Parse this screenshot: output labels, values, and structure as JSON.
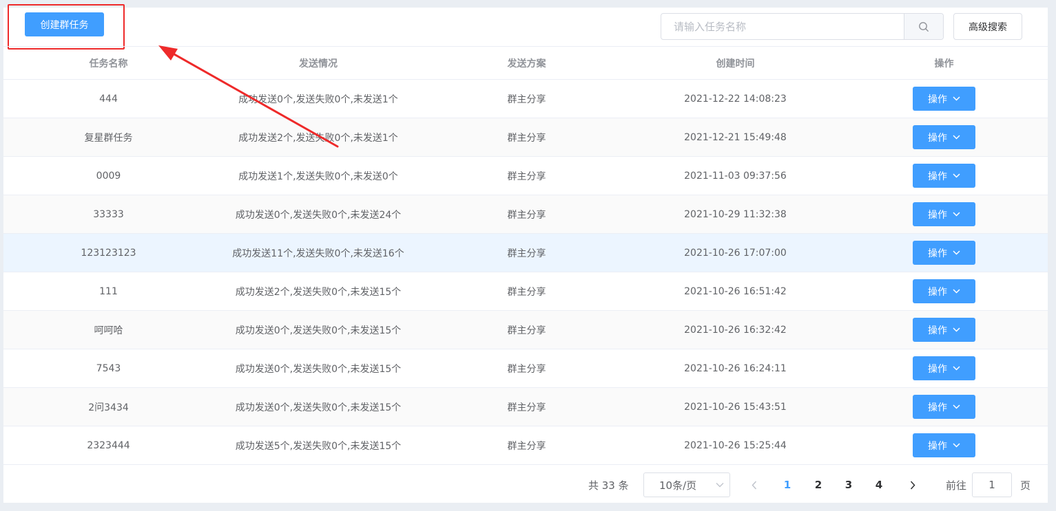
{
  "toolbar": {
    "create_label": "创建群任务",
    "search_placeholder": "请输入任务名称",
    "advanced_label": "高级搜索"
  },
  "table": {
    "columns": [
      "任务名称",
      "发送情况",
      "发送方案",
      "创建时间",
      "操作"
    ],
    "rows": [
      {
        "name": "444",
        "status": "成功发送0个,发送失败0个,未发送1个",
        "plan": "群主分享",
        "time": "2021-12-22 14:08:23",
        "action": "操作"
      },
      {
        "name": "复星群任务",
        "status": "成功发送2个,发送失败0个,未发送1个",
        "plan": "群主分享",
        "time": "2021-12-21 15:49:48",
        "action": "操作"
      },
      {
        "name": "0009",
        "status": "成功发送1个,发送失败0个,未发送0个",
        "plan": "群主分享",
        "time": "2021-11-03 09:37:56",
        "action": "操作"
      },
      {
        "name": "33333",
        "status": "成功发送0个,发送失败0个,未发送24个",
        "plan": "群主分享",
        "time": "2021-10-29 11:32:38",
        "action": "操作"
      },
      {
        "name": "123123123",
        "status": "成功发送11个,发送失败0个,未发送16个",
        "plan": "群主分享",
        "time": "2021-10-26 17:07:00",
        "action": "操作"
      },
      {
        "name": "111",
        "status": "成功发送2个,发送失败0个,未发送15个",
        "plan": "群主分享",
        "time": "2021-10-26 16:51:42",
        "action": "操作"
      },
      {
        "name": "呵呵哈",
        "status": "成功发送0个,发送失败0个,未发送15个",
        "plan": "群主分享",
        "time": "2021-10-26 16:32:42",
        "action": "操作"
      },
      {
        "name": "7543",
        "status": "成功发送0个,发送失败0个,未发送15个",
        "plan": "群主分享",
        "time": "2021-10-26 16:24:11",
        "action": "操作"
      },
      {
        "name": "2问3434",
        "status": "成功发送0个,发送失败0个,未发送15个",
        "plan": "群主分享",
        "time": "2021-10-26 15:43:51",
        "action": "操作"
      },
      {
        "name": "2323444",
        "status": "成功发送5个,发送失败0个,未发送15个",
        "plan": "群主分享",
        "time": "2021-10-26 15:25:44",
        "action": "操作"
      }
    ]
  },
  "pagination": {
    "total_text": "共 33 条",
    "page_size": "10条/页",
    "pages": [
      "1",
      "2",
      "3",
      "4"
    ],
    "current_page": "1",
    "goto_label": "前往",
    "goto_value": "1",
    "goto_suffix": "页"
  },
  "colors": {
    "primary": "#409eff",
    "annotation_red": "#ee2a2a"
  }
}
